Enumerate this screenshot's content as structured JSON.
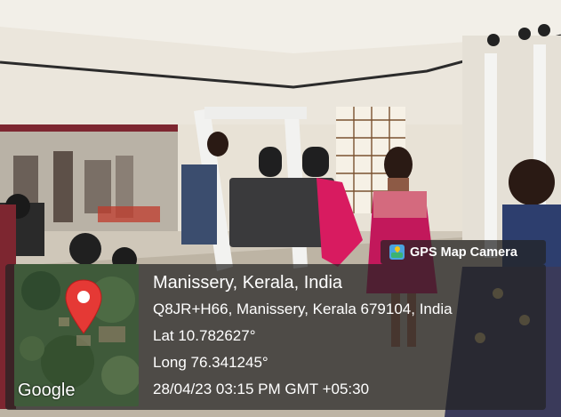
{
  "badge": {
    "icon": "gps-map-camera-app-icon",
    "label": "GPS Map Camera"
  },
  "location": {
    "place": "Manissery, Kerala, India",
    "address": "Q8JR+H66, Manissery, Kerala 679104, India",
    "latitude": "Lat 10.782627°",
    "longitude": "Long 76.341245°",
    "timestamp": "28/04/23 03:15 PM GMT +05:30"
  },
  "map": {
    "attribution": "Google",
    "marker_icon": "map-pin-icon",
    "marker_color": "#e53935"
  }
}
